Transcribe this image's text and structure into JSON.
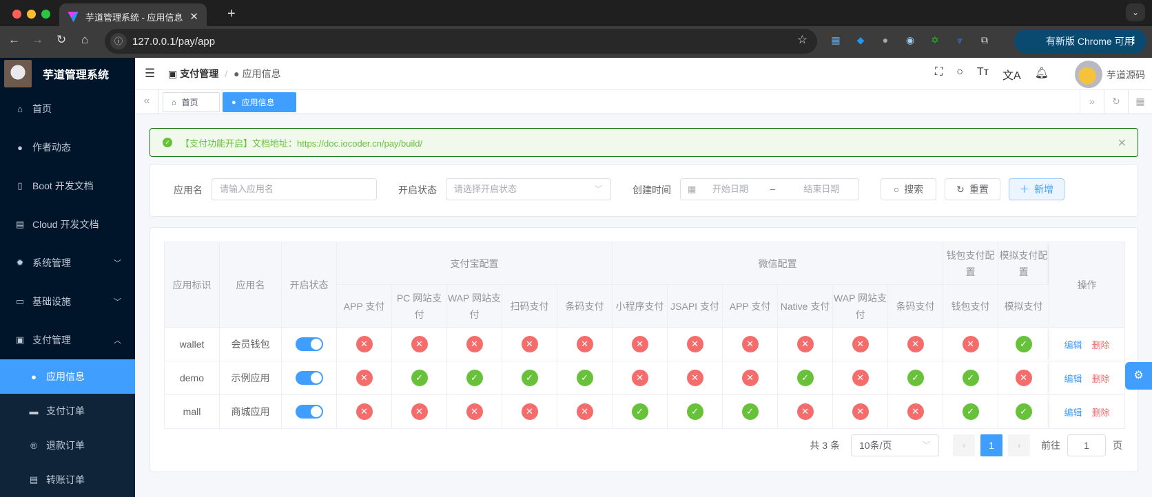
{
  "browser": {
    "tab_title": "芋道管理系统 - 应用信息",
    "url": "127.0.0.1/pay/app",
    "update_label": "有新版 Chrome 可用"
  },
  "sidebar": {
    "app_title": "芋道管理系统",
    "items": [
      {
        "label": "首页",
        "icon": "home-icon"
      },
      {
        "label": "作者动态",
        "icon": "user-icon"
      },
      {
        "label": "Boot 开发文档",
        "icon": "document-icon"
      },
      {
        "label": "Cloud 开发文档",
        "icon": "documents-icon"
      },
      {
        "label": "系统管理",
        "icon": "gear-icon",
        "expandable": true
      },
      {
        "label": "基础设施",
        "icon": "monitor-icon",
        "expandable": true
      },
      {
        "label": "支付管理",
        "icon": "payment-icon",
        "expanded": true
      }
    ],
    "sub_items": [
      {
        "label": "应用信息",
        "icon": "apple-icon",
        "active": true
      },
      {
        "label": "支付订单",
        "icon": "paypal-icon"
      },
      {
        "label": "退款订单",
        "icon": "registered-icon"
      },
      {
        "label": "转账订单",
        "icon": "transfer-icon"
      }
    ]
  },
  "header": {
    "breadcrumb": [
      "支付管理",
      "应用信息"
    ],
    "username": "芋道源码"
  },
  "tags": [
    {
      "label": "首页",
      "active": false
    },
    {
      "label": "应用信息",
      "active": true
    }
  ],
  "alert": {
    "text": "【支付功能开启】文档地址：https://doc.iocoder.cn/pay/build/"
  },
  "search": {
    "name_label": "应用名",
    "name_placeholder": "请输入应用名",
    "status_label": "开启状态",
    "status_placeholder": "请选择开启状态",
    "time_label": "创建时间",
    "start_placeholder": "开始日期",
    "range_sep": "–",
    "end_placeholder": "结束日期",
    "search_btn": "搜索",
    "reset_btn": "重置",
    "add_btn": "新增"
  },
  "table": {
    "headers": {
      "app_key": "应用标识",
      "app_name": "应用名",
      "status": "开启状态",
      "alipay_group": "支付宝配置",
      "wechat_group": "微信配置",
      "wallet_group": "钱包支付配置",
      "mock_group": "模拟支付配置",
      "actions": "操作"
    },
    "channels": [
      "APP 支付",
      "PC 网站支付",
      "WAP 网站支付",
      "扫码支付",
      "条码支付",
      "小程序支付",
      "JSAPI 支付",
      "APP 支付",
      "Native 支付",
      "WAP 网站支付",
      "条码支付",
      "钱包支付",
      "模拟支付"
    ],
    "rows": [
      {
        "key": "wallet",
        "name": "会员钱包",
        "enabled": true,
        "channels": [
          false,
          false,
          false,
          false,
          false,
          false,
          false,
          false,
          false,
          false,
          false,
          false,
          true
        ]
      },
      {
        "key": "demo",
        "name": "示例应用",
        "enabled": true,
        "channels": [
          false,
          true,
          true,
          true,
          true,
          false,
          false,
          false,
          true,
          false,
          true,
          true,
          false
        ]
      },
      {
        "key": "mall",
        "name": "商城应用",
        "enabled": true,
        "channels": [
          false,
          false,
          false,
          false,
          false,
          true,
          true,
          true,
          false,
          false,
          false,
          true,
          true
        ]
      }
    ],
    "edit_label": "编辑",
    "delete_label": "删除"
  },
  "pagination": {
    "total_text": "共 3 条",
    "page_size": "10条/页",
    "current_page": "1",
    "goto_label": "前往",
    "goto_value": "1",
    "page_suffix": "页"
  },
  "colors": {
    "primary": "#409eff",
    "success": "#67c23a",
    "danger": "#f56c6c",
    "sidebar_bg": "#001529"
  }
}
